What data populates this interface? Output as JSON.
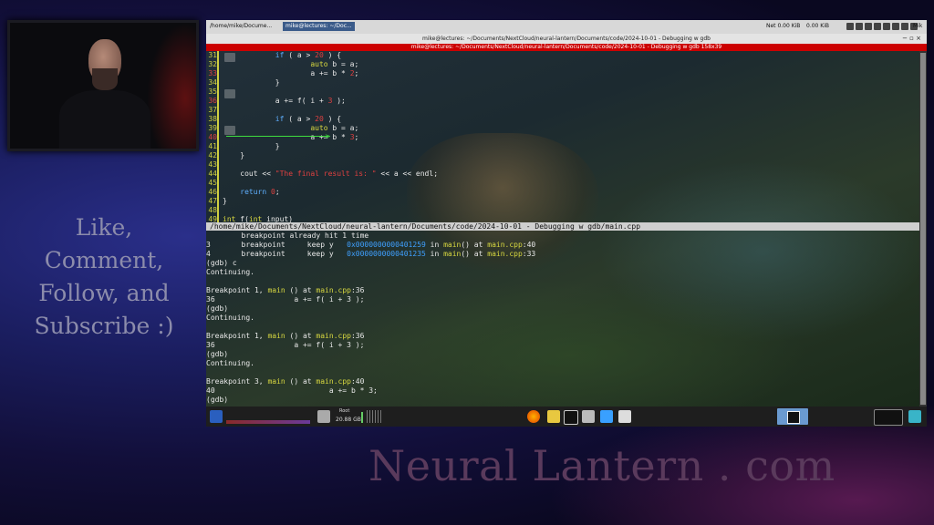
{
  "overlay": {
    "cta_lines": [
      "Like, Comment,",
      "Follow, and",
      "Subscribe :)"
    ],
    "brand": "Neural Lantern . com"
  },
  "topbar": {
    "task1": "/home/mike/Docume...",
    "task2": "mike@lectures: ~/Doc...",
    "net1": "Net 0.00 KiB",
    "net2": "0.00 KiB",
    "user": "Mik"
  },
  "window": {
    "title": "mike@lectures: ~/Documents/NextCloud/neural-lantern/Documents/code/2024-10-01 - Debugging w gdb",
    "controls": "− ▫ ×",
    "terminal_title": "mike@lectures: ~/Documents/NextCloud/neural-lantern/Documents/code/2024-10-01 - Debugging w gdb 158x39"
  },
  "source": {
    "lines": [
      {
        "n": "31",
        "red": false,
        "parts": [
          [
            "",
            "            "
          ],
          [
            "kw",
            "if"
          ],
          [
            "",
            " ( a > "
          ],
          [
            "num",
            "20"
          ],
          [
            "",
            " ) {"
          ]
        ]
      },
      {
        "n": "32",
        "red": false,
        "parts": [
          [
            "",
            "                    "
          ],
          [
            "ty",
            "auto"
          ],
          [
            "",
            " b = a;"
          ]
        ]
      },
      {
        "n": "33",
        "red": true,
        "parts": [
          [
            "",
            "                    a += b * "
          ],
          [
            "num",
            "2"
          ],
          [
            "",
            ";"
          ]
        ]
      },
      {
        "n": "34",
        "red": false,
        "parts": [
          [
            "",
            "            }"
          ]
        ]
      },
      {
        "n": "35",
        "red": false,
        "parts": [
          [
            "",
            ""
          ]
        ]
      },
      {
        "n": "36",
        "red": true,
        "parts": [
          [
            "",
            "            a += f( i + "
          ],
          [
            "num",
            "3"
          ],
          [
            "",
            " );"
          ]
        ]
      },
      {
        "n": "37",
        "red": false,
        "parts": [
          [
            "",
            ""
          ]
        ]
      },
      {
        "n": "38",
        "red": false,
        "parts": [
          [
            "",
            "            "
          ],
          [
            "kw",
            "if"
          ],
          [
            "",
            " ( a > "
          ],
          [
            "num",
            "20"
          ],
          [
            "",
            " ) {"
          ]
        ]
      },
      {
        "n": "39",
        "red": false,
        "parts": [
          [
            "",
            "                    "
          ],
          [
            "ty",
            "auto"
          ],
          [
            "",
            " b = a;"
          ]
        ]
      },
      {
        "n": "40",
        "red": true,
        "parts": [
          [
            "",
            "                    a += b * "
          ],
          [
            "num",
            "3"
          ],
          [
            "",
            ";"
          ]
        ]
      },
      {
        "n": "41",
        "red": false,
        "parts": [
          [
            "",
            "            }"
          ]
        ]
      },
      {
        "n": "42",
        "red": false,
        "parts": [
          [
            "",
            "    }"
          ]
        ]
      },
      {
        "n": "43",
        "red": false,
        "parts": [
          [
            "",
            ""
          ]
        ]
      },
      {
        "n": "44",
        "red": false,
        "parts": [
          [
            "",
            "    cout << "
          ],
          [
            "str",
            "\"The final result is: \""
          ],
          [
            "",
            " << a << endl;"
          ]
        ]
      },
      {
        "n": "45",
        "red": false,
        "parts": [
          [
            "",
            ""
          ]
        ]
      },
      {
        "n": "46",
        "red": false,
        "parts": [
          [
            "",
            "    "
          ],
          [
            "kw",
            "return"
          ],
          [
            "",
            " "
          ],
          [
            "num",
            "0"
          ],
          [
            "",
            ";"
          ]
        ]
      },
      {
        "n": "47",
        "red": false,
        "parts": [
          [
            "",
            "}"
          ]
        ]
      },
      {
        "n": "48",
        "red": false,
        "parts": [
          [
            "",
            ""
          ]
        ]
      },
      {
        "n": "49",
        "red": false,
        "parts": [
          [
            "ty",
            "int"
          ],
          [
            "",
            " f("
          ],
          [
            "ty",
            "int"
          ],
          [
            "",
            " input)"
          ]
        ]
      }
    ]
  },
  "status_line": "/home/mike/Documents/NextCloud/neural-lantern/Documents/code/2024-10-01 - Debugging w gdb/main.cpp",
  "gdb": {
    "lines": [
      [
        [
          "",
          "        breakpoint already hit 1 time"
        ]
      ],
      [
        [
          "",
          "3       breakpoint     keep y   "
        ],
        [
          "addr",
          "0x0000000000401259"
        ],
        [
          "",
          " in "
        ],
        [
          "fn",
          "main"
        ],
        [
          "",
          "() at "
        ],
        [
          "file",
          "main.cpp"
        ],
        [
          "",
          ":40"
        ]
      ],
      [
        [
          "",
          "4       breakpoint     keep y   "
        ],
        [
          "addr",
          "0x0000000000401235"
        ],
        [
          "",
          " in "
        ],
        [
          "fn",
          "main"
        ],
        [
          "",
          "() at "
        ],
        [
          "file",
          "main.cpp"
        ],
        [
          "",
          ":33"
        ]
      ],
      [
        [
          "",
          "(gdb) c"
        ]
      ],
      [
        [
          "",
          "Continuing."
        ]
      ],
      [
        [
          "",
          ""
        ]
      ],
      [
        [
          "",
          "Breakpoint 1, "
        ],
        [
          "fn",
          "main"
        ],
        [
          "",
          " () at "
        ],
        [
          "file",
          "main.cpp"
        ],
        [
          "",
          ":36"
        ]
      ],
      [
        [
          "",
          "36                  a += f( i + 3 );"
        ]
      ],
      [
        [
          "",
          "(gdb)"
        ]
      ],
      [
        [
          "",
          "Continuing."
        ]
      ],
      [
        [
          "",
          ""
        ]
      ],
      [
        [
          "",
          "Breakpoint 1, "
        ],
        [
          "fn",
          "main"
        ],
        [
          "",
          " () at "
        ],
        [
          "file",
          "main.cpp"
        ],
        [
          "",
          ":36"
        ]
      ],
      [
        [
          "",
          "36                  a += f( i + 3 );"
        ]
      ],
      [
        [
          "",
          "(gdb)"
        ]
      ],
      [
        [
          "",
          "Continuing."
        ]
      ],
      [
        [
          "",
          ""
        ]
      ],
      [
        [
          "",
          "Breakpoint 3, "
        ],
        [
          "fn",
          "main"
        ],
        [
          "",
          " () at "
        ],
        [
          "file",
          "main.cpp"
        ],
        [
          "",
          ":40"
        ]
      ],
      [
        [
          "",
          "40                          a += b * 3;"
        ]
      ],
      [
        [
          "",
          "(gdb)"
        ]
      ]
    ]
  },
  "taskbar": {
    "disk_label": "Root",
    "disk_size": "20.88 GB"
  },
  "icons": {
    "launcher": "app-menu-icon",
    "firefox": "firefox-icon",
    "terminal": "terminal-icon",
    "files": "file-manager-icon"
  }
}
